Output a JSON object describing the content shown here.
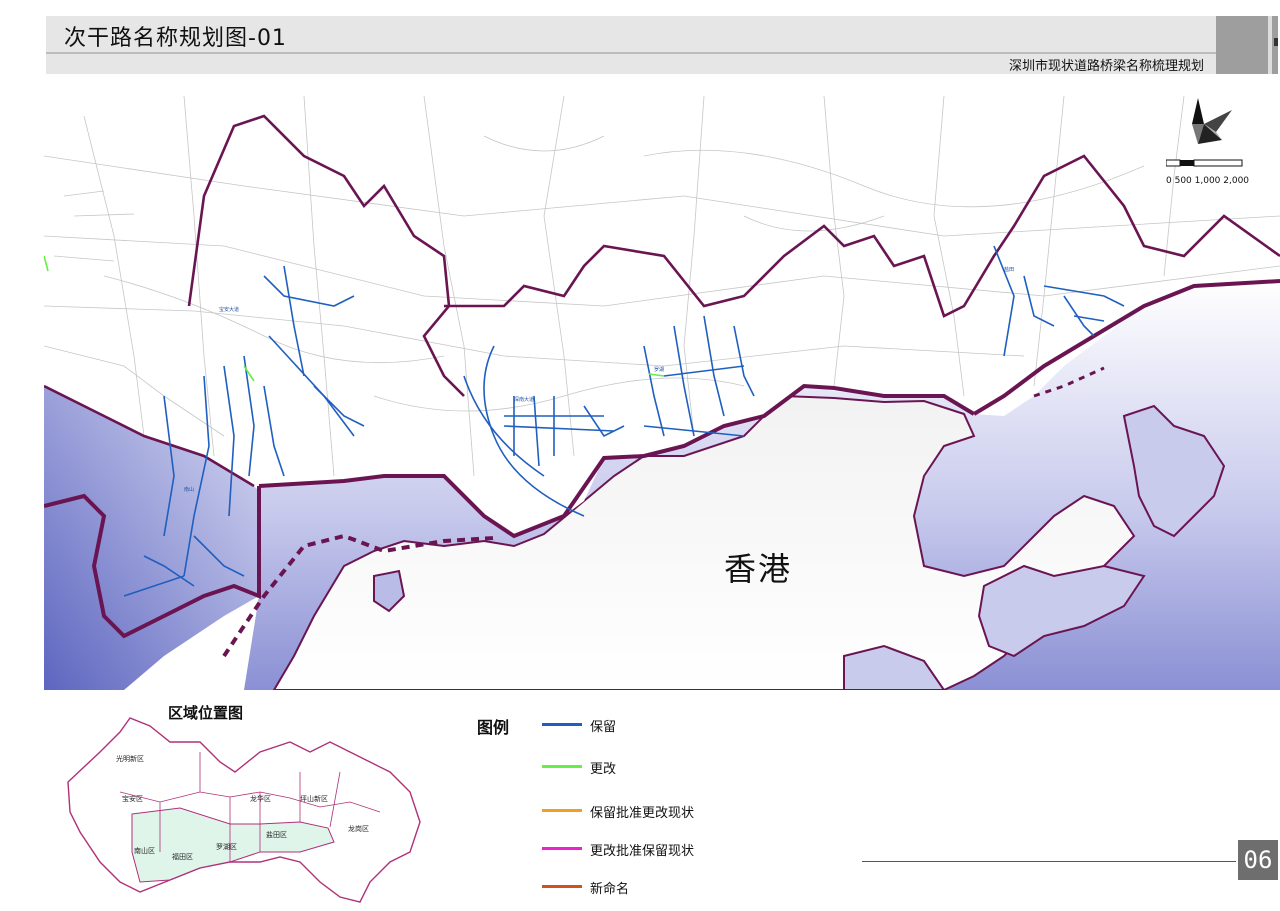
{
  "header": {
    "title": "次干路名称规划图-01",
    "subtitle": "深圳市现状道路桥梁名称梳理规划"
  },
  "map": {
    "hong_kong_label": "香港",
    "north_label": "N",
    "scale_label": "0 500 1,000    2,000",
    "colors": {
      "sea": "#7f86cc",
      "land": "#ffffff",
      "boundary": "#6a1552",
      "roads_minor": "#b8b8b8",
      "road_retain": "#1f5fbf"
    }
  },
  "inset": {
    "title": "区域位置图",
    "districts": [
      {
        "name": "光明新区"
      },
      {
        "name": "宝安区"
      },
      {
        "name": "龙华区"
      },
      {
        "name": "坪山新区"
      },
      {
        "name": "龙岗区"
      },
      {
        "name": "南山区"
      },
      {
        "name": "福田区"
      },
      {
        "name": "罗湖区"
      },
      {
        "name": "盐田区"
      }
    ],
    "colors": {
      "outline": "#b0307a",
      "highlight": "#dff5e9"
    }
  },
  "legend": {
    "title": "图例",
    "items": [
      {
        "label": "保留",
        "color": "#1f5fbf"
      },
      {
        "label": "更改",
        "color": "#66ee44"
      },
      {
        "label": "保留批准更改现状",
        "color": "#f0a020"
      },
      {
        "label": "更改批准保留现状",
        "color": "#ee22cc"
      },
      {
        "label": "新命名",
        "color": "#d0541a"
      }
    ]
  },
  "footer": {
    "page_number": "06"
  }
}
